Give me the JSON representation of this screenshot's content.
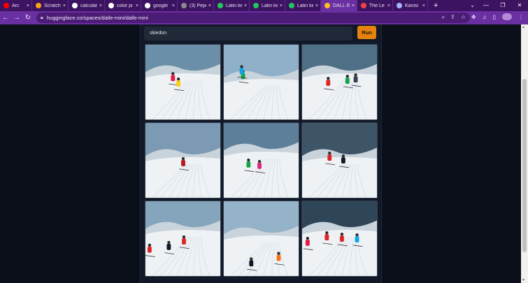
{
  "browser": {
    "tabs": [
      {
        "title": "Arc",
        "favicon_color": "#ff0000",
        "active": false
      },
      {
        "title": "Scratch",
        "favicon_color": "#f4a316",
        "active": false
      },
      {
        "title": "calculat",
        "favicon_color": "#ffffff",
        "active": false
      },
      {
        "title": "color pi",
        "favicon_color": "#ffffff",
        "active": false
      },
      {
        "title": "google",
        "favicon_color": "#ffffff",
        "active": false
      },
      {
        "title": "(3) Pepe",
        "favicon_color": "#8a8a8a",
        "active": false
      },
      {
        "title": "Latin ke",
        "favicon_color": "#22c55e",
        "active": false
      },
      {
        "title": "Latin ke",
        "favicon_color": "#22c55e",
        "active": false
      },
      {
        "title": "Latin ke",
        "favicon_color": "#22c55e",
        "active": false
      },
      {
        "title": "DALL·E",
        "favicon_color": "#fbbf24",
        "active": true
      },
      {
        "title": "The Le",
        "favicon_color": "#ef4444",
        "active": false
      },
      {
        "title": "Kanisi",
        "favicon_color": "#a5b4fc",
        "active": false
      }
    ],
    "close_glyph": "×",
    "new_tab_glyph": "+",
    "url": "huggingface.co/spaces/dalle-mini/dalle-mini",
    "accent": "#6a2fa0"
  },
  "app": {
    "prompt_value": "skiedon",
    "run_label": "Run",
    "run_color": "#e6820e",
    "images": [
      {
        "scene": "skier-close-left"
      },
      {
        "scene": "skier-spray"
      },
      {
        "scene": "skiers-distant"
      },
      {
        "scene": "slope-empty"
      },
      {
        "scene": "mountain-valley"
      },
      {
        "scene": "skier-fall"
      },
      {
        "scene": "slope-group"
      },
      {
        "scene": "slope-single"
      },
      {
        "scene": "skiers-front"
      }
    ]
  }
}
